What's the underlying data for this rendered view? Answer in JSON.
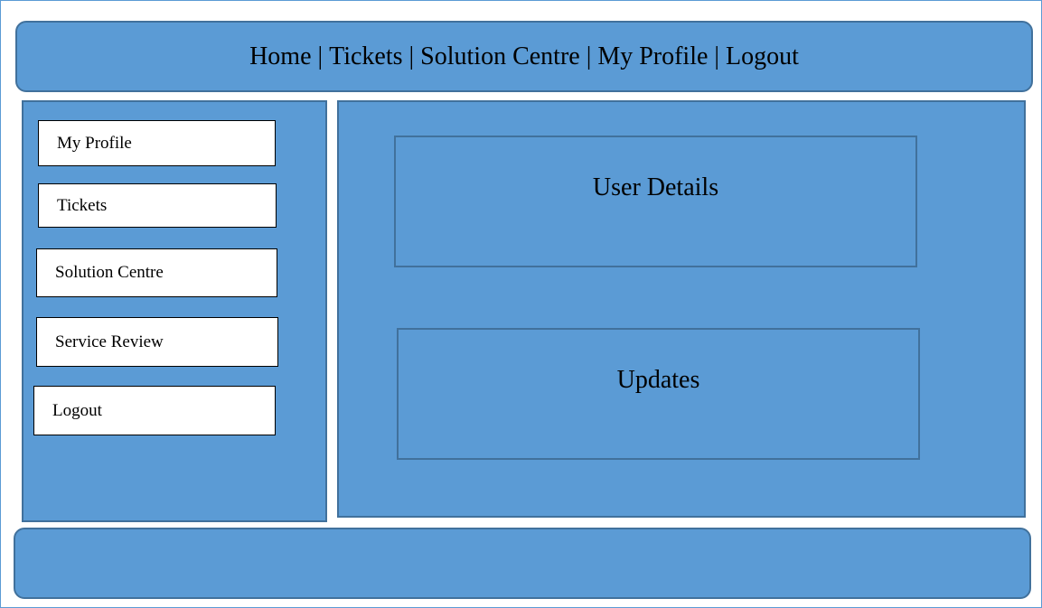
{
  "header": {
    "nav": [
      "Home",
      "Tickets",
      "Solution Centre",
      "My Profile",
      "Logout"
    ],
    "separator": "|"
  },
  "sidebar": {
    "items": [
      {
        "label": "My Profile"
      },
      {
        "label": "Tickets"
      },
      {
        "label": "Solution Centre"
      },
      {
        "label": "Service Review"
      },
      {
        "label": "Logout"
      }
    ]
  },
  "main": {
    "user_details_title": "User Details",
    "updates_title": "Updates"
  },
  "colors": {
    "panel_fill": "#5b9bd5",
    "panel_border": "#41719c",
    "button_fill": "#ffffff"
  }
}
